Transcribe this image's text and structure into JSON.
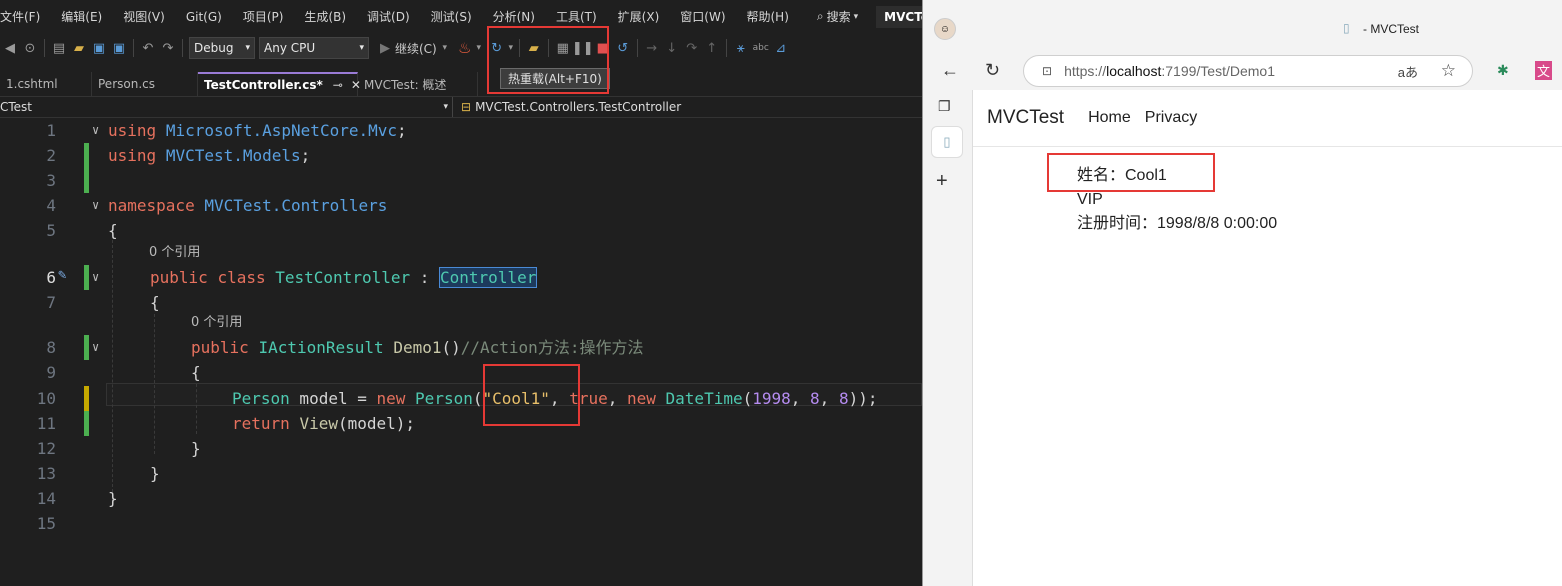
{
  "vs": {
    "menu": [
      "文件(F)",
      "编辑(E)",
      "视图(V)",
      "Git(G)",
      "项目(P)",
      "生成(B)",
      "调试(D)",
      "测试(S)",
      "分析(N)",
      "工具(T)",
      "扩展(X)",
      "窗口(W)",
      "帮助(H)"
    ],
    "search_label": "搜索",
    "project_name": "MVCTest",
    "toolbar": {
      "config": "Debug",
      "platform": "Any CPU",
      "continue_label": "继续(C)"
    },
    "tooltip": "热重载(Alt+F10)",
    "tabs": [
      {
        "label": "1.cshtml",
        "active": false
      },
      {
        "label": "Person.cs",
        "active": false
      },
      {
        "label": "TestController.cs*",
        "active": true
      },
      {
        "label": "MVCTest: 概述",
        "active": false
      }
    ],
    "nav": {
      "project": "CTest",
      "member": "MVCTest.Controllers.TestController"
    },
    "hints": {
      "ref_class": "0 个引用",
      "ref_method": "0 个引用"
    },
    "line_numbers": [
      "1",
      "2",
      "3",
      "4",
      "5",
      "6",
      "7",
      "8",
      "9",
      "10",
      "11",
      "12",
      "13",
      "14",
      "15"
    ],
    "code": {
      "l1_kw": "using",
      "l1_ns": "Microsoft.AspNetCore.Mvc",
      "l1_end": ";",
      "l2_kw": "using",
      "l2_ns": "MVCTest.Models",
      "l2_end": ";",
      "l4_kw": "namespace",
      "l4_ns": "MVCTest.Controllers",
      "l5": "{",
      "l6_kw1": "public",
      "l6_kw2": "class",
      "l6_name": "TestController",
      "l6_colon": " : ",
      "l6_base": "Controller",
      "l7": "{",
      "l8_kw": "public",
      "l8_type": "IActionResult",
      "l8_name": "Demo1",
      "l8_paren": "()",
      "l8_comment": "//Action方法:操作方法",
      "l9": "{",
      "l10_type": "Person",
      "l10_var": " model = ",
      "l10_new": "new",
      "l10_ctor": "Person",
      "l10_p1": "(",
      "l10_str": "\"Cool1\"",
      "l10_c1": ", ",
      "l10_true": "true",
      "l10_c2": ", ",
      "l10_new2": "new",
      "l10_dt": "DateTime",
      "l10_p2": "(",
      "l10_n1": "1998",
      "l10_c3": ", ",
      "l10_n2": "8",
      "l10_c4": ", ",
      "l10_n3": "8",
      "l10_end": "));",
      "l11_kw": "return",
      "l11_fn": "View",
      "l11_arg": "(model);",
      "l12": "}",
      "l13": "}",
      "l14": "}"
    }
  },
  "browser": {
    "title": "- MVCTest",
    "url_scheme": "https://",
    "url_host": "localhost",
    "url_rest": ":7199/Test/Demo1",
    "brand": "MVCTest",
    "nav_links": [
      "Home",
      "Privacy"
    ],
    "content": {
      "name_line": "姓名：Cool1",
      "vip": "VIP",
      "reg_line": "注册时间：1998/8/8 0:00:00"
    }
  },
  "colors": {
    "highlight_red": "#e53935",
    "keyword": "#e6715e",
    "namespace": "#5aa0e0",
    "type": "#4ec9b0",
    "string": "#e8bf6a",
    "number": "#b58cf0"
  }
}
